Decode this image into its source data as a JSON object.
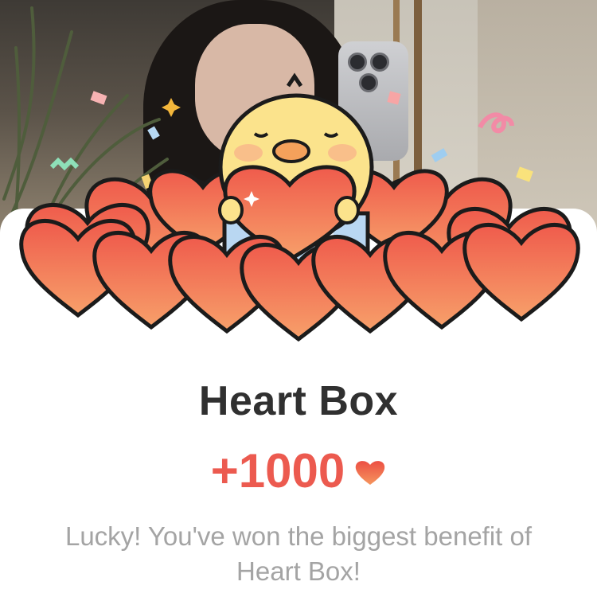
{
  "modal": {
    "title": "Heart Box",
    "reward_amount": "+1000",
    "reward_icon": "heart-icon",
    "message": "Lucky! You've won the biggest benefit of Heart Box!"
  },
  "colors": {
    "title": "#303030",
    "reward": "#ec5a4f",
    "message": "#a4a4a4",
    "heart_fill": "#f47a5e",
    "chick": "#fbe38c"
  }
}
